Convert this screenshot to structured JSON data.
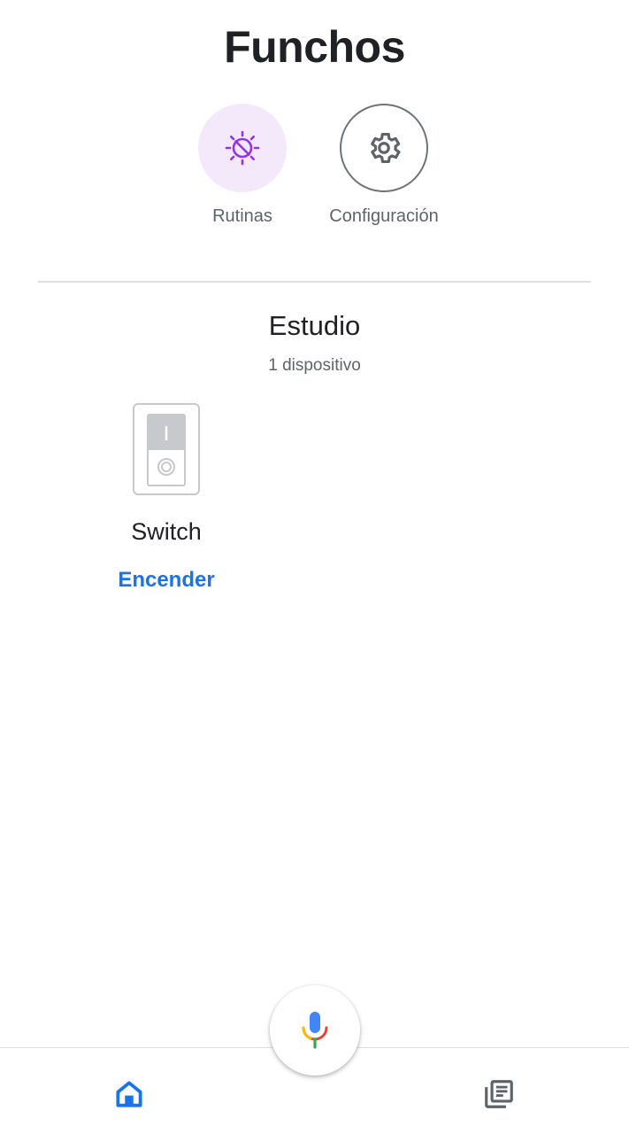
{
  "home": {
    "title": "Funchos"
  },
  "actions": [
    {
      "label": "Rutinas",
      "icon": "routines-icon",
      "accent": "#9334e6",
      "background": "#f4e8fb"
    },
    {
      "label": "Configuración",
      "icon": "gear-icon",
      "accent": "#5f6368"
    }
  ],
  "room": {
    "name": "Estudio",
    "device_count": "1 dispositivo",
    "devices": [
      {
        "name": "Switch",
        "icon": "switch-icon",
        "action": "Encender",
        "action_color": "#1a73e8"
      }
    ]
  },
  "navigation": {
    "items": [
      {
        "icon": "home-icon",
        "active": true,
        "color": "#1a73e8"
      },
      {
        "icon": "feed-icon",
        "active": false,
        "color": "#5f6368"
      }
    ],
    "assistant": {
      "icon": "mic-icon"
    }
  }
}
